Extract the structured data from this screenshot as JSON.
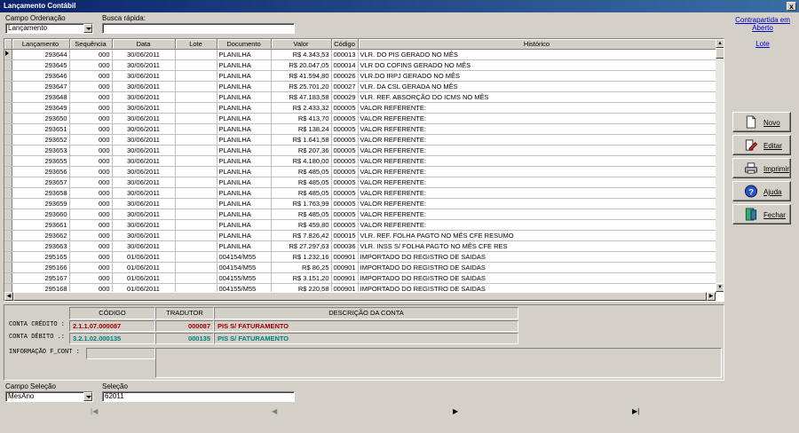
{
  "window": {
    "title": "Lançamento Contábil",
    "close_label": "x"
  },
  "top": {
    "ordenacao_label": "Campo Ordenação",
    "ordenacao_value": "Lançamento",
    "busca_label": "Busca rápida:",
    "busca_value": ""
  },
  "grid": {
    "headers": [
      "Lançamento",
      "Sequência",
      "Data",
      "Lote",
      "Documento",
      "Valor",
      "Código",
      "Histórico"
    ],
    "rows": [
      [
        "293644",
        "000",
        "30/06/2011",
        "",
        "PLANILHA",
        "R$ 4.343,53",
        "000013",
        "VLR. DO PIS GERADO NO MÊS"
      ],
      [
        "293645",
        "000",
        "30/06/2011",
        "",
        "PLANILHA",
        "R$ 20.047,05",
        "000014",
        "VLR DO COFINS GERADO NO MÊS"
      ],
      [
        "293646",
        "000",
        "30/06/2011",
        "",
        "PLANILHA",
        "R$ 41.594,80",
        "000026",
        "VLR.DO IRPJ GERADO NO MÊS"
      ],
      [
        "293647",
        "000",
        "30/06/2011",
        "",
        "PLANILHA",
        "R$ 25.701,20",
        "000027",
        "VLR. DA CSL GERADA NO MÊS"
      ],
      [
        "293648",
        "000",
        "30/06/2011",
        "",
        "PLANILHA",
        "R$ 47.183,58",
        "000029",
        "VLR. REF. ABSORÇÃO DO ICMS NO MÊS"
      ],
      [
        "293649",
        "000",
        "30/06/2011",
        "",
        "PLANILHA",
        "R$ 2.433,32",
        "000005",
        "VALOR REFERENTE:"
      ],
      [
        "293650",
        "000",
        "30/06/2011",
        "",
        "PLANILHA",
        "R$ 413,70",
        "000005",
        "VALOR REFERENTE:"
      ],
      [
        "293651",
        "000",
        "30/06/2011",
        "",
        "PLANILHA",
        "R$ 138,24",
        "000005",
        "VALOR REFERENTE:"
      ],
      [
        "293652",
        "000",
        "30/06/2011",
        "",
        "PLANILHA",
        "R$ 1.641,58",
        "000005",
        "VALOR REFERENTE:"
      ],
      [
        "293653",
        "000",
        "30/06/2011",
        "",
        "PLANILHA",
        "R$ 207,36",
        "000005",
        "VALOR REFERENTE:"
      ],
      [
        "293655",
        "000",
        "30/06/2011",
        "",
        "PLANILHA",
        "R$ 4.180,00",
        "000005",
        "VALOR REFERENTE:"
      ],
      [
        "293656",
        "000",
        "30/06/2011",
        "",
        "PLANILHA",
        "R$ 485,05",
        "000005",
        "VALOR REFERENTE:"
      ],
      [
        "293657",
        "000",
        "30/06/2011",
        "",
        "PLANILHA",
        "R$ 485,05",
        "000005",
        "VALOR REFERENTE:"
      ],
      [
        "293658",
        "000",
        "30/06/2011",
        "",
        "PLANILHA",
        "R$ 485,05",
        "000005",
        "VALOR REFERENTE:"
      ],
      [
        "293659",
        "000",
        "30/06/2011",
        "",
        "PLANILHA",
        "R$ 1.763,99",
        "000005",
        "VALOR REFERENTE:"
      ],
      [
        "293660",
        "000",
        "30/06/2011",
        "",
        "PLANILHA",
        "R$ 485,05",
        "000005",
        "VALOR REFERENTE:"
      ],
      [
        "293661",
        "000",
        "30/06/2011",
        "",
        "PLANILHA",
        "R$ 459,80",
        "000005",
        "VALOR REFERENTE:"
      ],
      [
        "293662",
        "000",
        "30/06/2011",
        "",
        "PLANILHA",
        "R$ 7.826,42",
        "000015",
        "VLR. REF. FOLHA PAGTO NO MÊS CFE RESUMO"
      ],
      [
        "293663",
        "000",
        "30/06/2011",
        "",
        "PLANILHA",
        "R$ 27.297,63",
        "000036",
        "VLR. INSS S/ FOLHA PAGTO NO MÊS CFE RES"
      ],
      [
        "295165",
        "000",
        "01/06/2011",
        "",
        "004154/M55",
        "R$ 1.232,16",
        "000901",
        "IMPORTADO DO REGISTRO DE SAIDAS"
      ],
      [
        "295166",
        "000",
        "01/06/2011",
        "",
        "004154/M55",
        "R$ 86,25",
        "000901",
        "IMPORTADO DO REGISTRO DE SAIDAS"
      ],
      [
        "295167",
        "000",
        "01/06/2011",
        "",
        "004155/M55",
        "R$ 3.151,20",
        "000901",
        "IMPORTADO DO REGISTRO DE SAIDAS"
      ],
      [
        "295168",
        "000",
        "01/06/2011",
        "",
        "004155/M55",
        "R$ 220,58",
        "000901",
        "IMPORTADO DO REGISTRO DE SAIDAS"
      ]
    ]
  },
  "detail": {
    "codigo_header": "CÓDIGO",
    "tradutor_header": "TRADUTOR",
    "descricao_header": "DESCRIÇÃO DA CONTA",
    "credito_label": "CONTA CRÉDITO :",
    "credito_codigo": "2.1.1.07.000087",
    "credito_tradutor": "000087",
    "credito_descricao": "PIS S/ FATURAMENTO",
    "debito_label": "CONTA DÉBITO .:",
    "debito_codigo": "3.2.1.02.000135",
    "debito_tradutor": "000135",
    "debito_descricao": "PIS S/ FATURAMENTO",
    "info_label": "INFORMAÇÃO F_CONT :"
  },
  "bottom": {
    "selecao_campo_label": "Campo Seleção",
    "selecao_campo_value": "MesAno",
    "selecao_label": "Seleção",
    "selecao_value": "62011"
  },
  "side": {
    "link_contrapartida": "Contrapartida em Aberto",
    "link_lote": "Lote",
    "novo": "Novo",
    "editar": "Editar",
    "imprimir": "Imprimir",
    "ajuda": "Ajuda",
    "fechar": "Fechar"
  },
  "nav": {
    "first": "|◀",
    "prev": "◀",
    "next": "▶",
    "last": "▶|"
  }
}
